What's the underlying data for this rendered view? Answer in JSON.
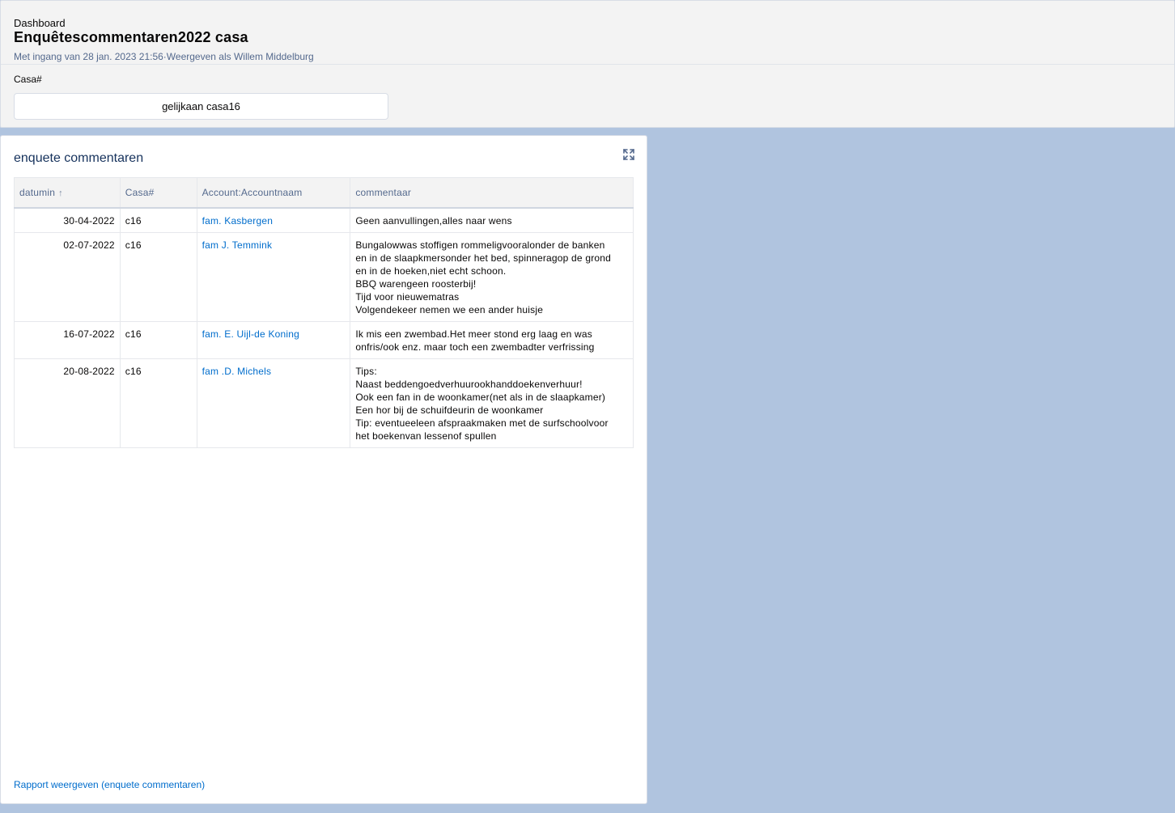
{
  "header": {
    "breadcrumb": "Dashboard",
    "title": "Enquêtescommentaren2022 casa",
    "subtitle": "Met ingang van 28 jan. 2023 21:56·Weergeven als Willem Middelburg"
  },
  "filter": {
    "label": "Casa#",
    "value": "gelijkaan casa16"
  },
  "widget": {
    "title": "enquete commentaren",
    "expand_icon": "expand-icon",
    "columns": [
      "datumin",
      "Casa#",
      "Account:Accountnaam",
      "commentaar"
    ],
    "sort_icon": "↑",
    "rows": [
      {
        "date": "30-04-2022",
        "casa": "c16",
        "account": "fam. Kasbergen",
        "comment": "Geen aanvullingen,alles naar wens"
      },
      {
        "date": "02-07-2022",
        "casa": "c16",
        "account": "fam J. Temmink",
        "comment": "Bungalowwas stoffigen rommeligvooralonder de banken\nen in de slaapkmersonder het bed, spinneragop de grond\nen in de hoeken,niet echt schoon.\nBBQ warengeen roosterbij!\nTijd voor nieuwematras\nVolgendekeer nemen we een ander huisje"
      },
      {
        "date": "16-07-2022",
        "casa": "c16",
        "account": "fam. E. Uijl-de Koning",
        "comment": "Ik mis een zwembad.Het meer stond erg laag en was\nonfris/ook enz. maar toch een zwembadter verfrissing"
      },
      {
        "date": "20-08-2022",
        "casa": "c16",
        "account": "fam .D. Michels",
        "comment": "Tips:\nNaast beddengoedverhuurookhanddoekenverhuur!\nOok een fan in de woonkamer(net als in de slaapkamer)\nEen hor bij de schuifdeurin de woonkamer\nTip: eventueeleen afspraakmaken met de surfschoolvoor\nhet boekenvan lessenof spullen"
      }
    ],
    "report_link": "Rapport weergeven (enquete commentaren)"
  },
  "colors": {
    "background": "#b0c4df",
    "link": "#006dcc",
    "header_bg": "#f3f3f3"
  }
}
